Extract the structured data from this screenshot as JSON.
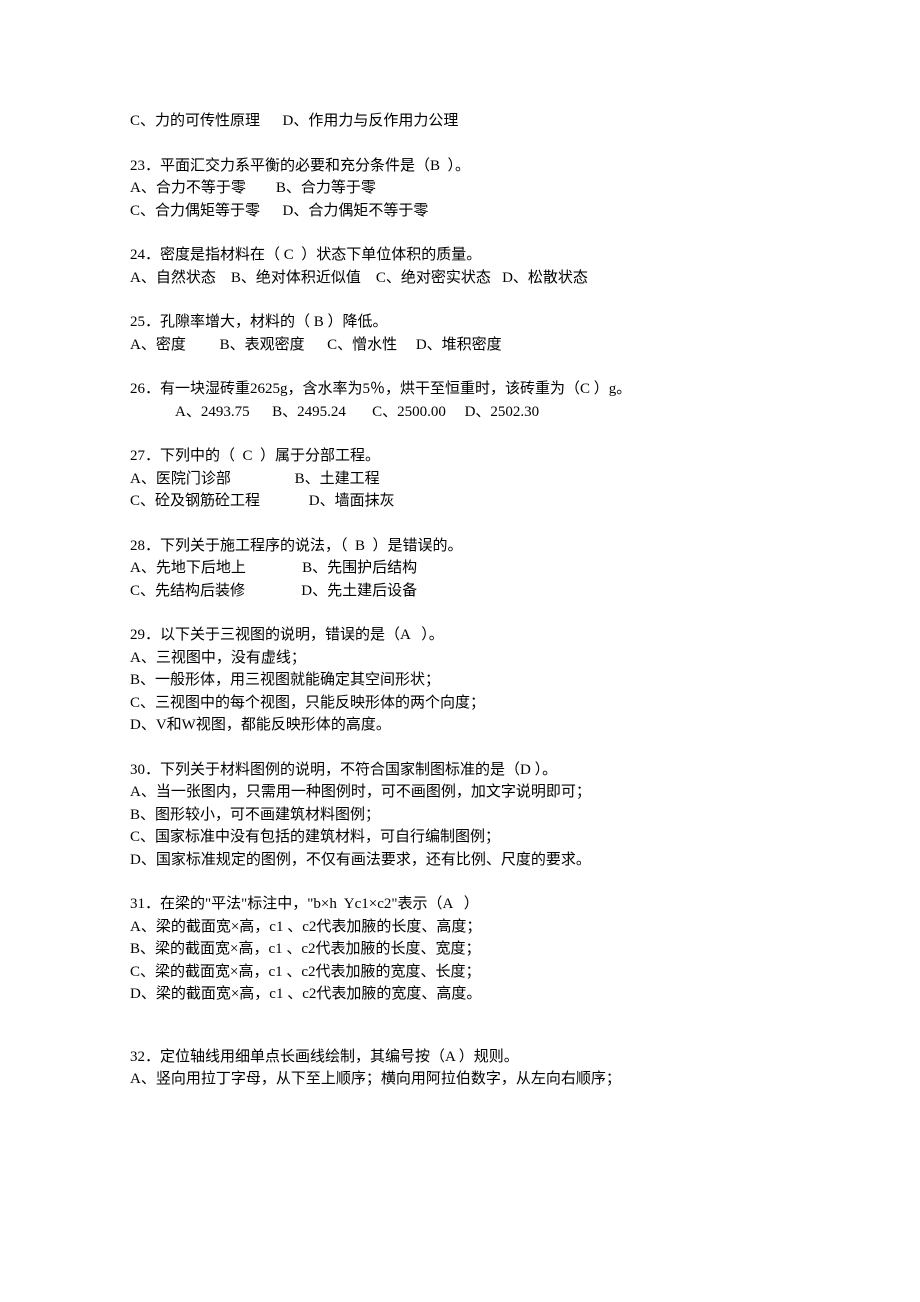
{
  "q22_cont": {
    "line1": "C、力的可传性原理      D、作用力与反作用力公理"
  },
  "q23": {
    "stem": "23．平面汇交力系平衡的必要和充分条件是（B  ）。",
    "line1": "A、合力不等于零        B、合力等于零",
    "line2": "C、合力偶矩等于零      D、合力偶矩不等于零"
  },
  "q24": {
    "stem": "24．密度是指材料在（ C  ）状态下单位体积的质量。",
    "line1": "A、自然状态    B、绝对体积近似值    C、绝对密实状态   D、松散状态"
  },
  "q25": {
    "stem": "25．孔隙率增大，材料的（ B ）降低。",
    "line1": "A、密度         B、表观密度      C、憎水性     D、堆积密度"
  },
  "q26": {
    "stem": "26．有一块湿砖重2625g，含水率为5％，烘干至恒重时，该砖重为（C ）g。",
    "line1": "A、2493.75      B、2495.24       C、2500.00     D、2502.30"
  },
  "q27": {
    "stem": "27．下列中的（  C  ）属于分部工程。",
    "line1": "A、医院门诊部                 B、土建工程",
    "line2": "C、砼及钢筋砼工程             D、墙面抹灰"
  },
  "q28": {
    "stem": "28．下列关于施工程序的说法，（  B  ）是错误的。",
    "line1": "A、先地下后地上               B、先围护后结构",
    "line2": "C、先结构后装修               D、先土建后设备"
  },
  "q29": {
    "stem": "29．以下关于三视图的说明，错误的是（A   ）。",
    "a": "A、三视图中，没有虚线；",
    "b": "B、一般形体，用三视图就能确定其空间形状；",
    "c": "C、三视图中的每个视图，只能反映形体的两个向度；",
    "d": "D、V和W视图，都能反映形体的高度。"
  },
  "q30": {
    "stem": "30．下列关于材料图例的说明，不符合国家制图标准的是（D ）。",
    "a": "A、当一张图内，只需用一种图例时，可不画图例，加文字说明即可；",
    "b": "B、图形较小，可不画建筑材料图例；",
    "c": "C、国家标准中没有包括的建筑材料，可自行编制图例；",
    "d": "D、国家标准规定的图例，不仅有画法要求，还有比例、尺度的要求。"
  },
  "q31": {
    "stem": "31．在梁的\"平法\"标注中，\"b×h  Yc1×c2\"表示（A   ）",
    "a": "A、梁的截面宽×高，c1 、c2代表加腋的长度、高度；",
    "b": "B、梁的截面宽×高，c1 、c2代表加腋的长度、宽度；",
    "c": "C、梁的截面宽×高，c1 、c2代表加腋的宽度、长度；",
    "d": "D、梁的截面宽×高，c1 、c2代表加腋的宽度、高度。"
  },
  "q32": {
    "stem": "32．定位轴线用细单点长画线绘制，其编号按（A ）规则。",
    "a": "A、竖向用拉丁字母，从下至上顺序；横向用阿拉伯数字，从左向右顺序；"
  }
}
